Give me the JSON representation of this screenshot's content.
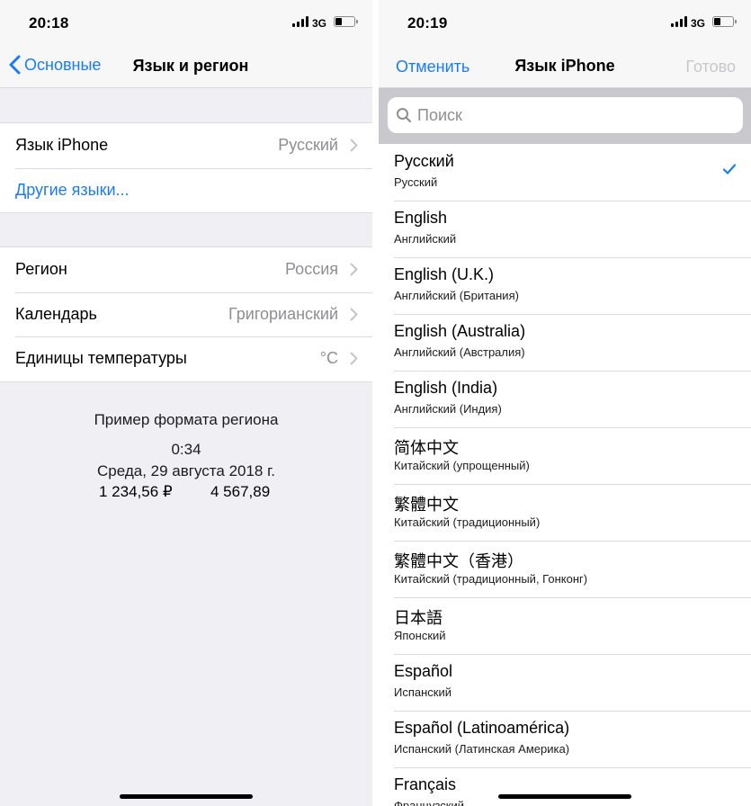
{
  "left": {
    "status": {
      "time": "20:18",
      "network": "3G"
    },
    "nav": {
      "back_label": "Основные",
      "title": "Язык и регион"
    },
    "group1": [
      {
        "label": "Язык iPhone",
        "value": "Русский"
      }
    ],
    "other_languages": "Другие языки...",
    "group2": [
      {
        "label": "Регион",
        "value": "Россия"
      },
      {
        "label": "Календарь",
        "value": "Григорианский"
      },
      {
        "label": "Единицы температуры",
        "value": "°C"
      }
    ],
    "example": {
      "heading": "Пример формата региона",
      "time": "0:34",
      "date": "Среда, 29 августа 2018 г.",
      "currency": "1 234,56 ₽",
      "number": "4 567,89"
    }
  },
  "right": {
    "status": {
      "time": "20:19",
      "network": "3G"
    },
    "nav": {
      "cancel_label": "Отменить",
      "title": "Язык iPhone",
      "done_label": "Готово"
    },
    "search": {
      "placeholder": "Поиск"
    },
    "languages": [
      {
        "name": "Русский",
        "native": "Русский",
        "selected": true
      },
      {
        "name": "English",
        "native": "Английский"
      },
      {
        "name": "English (U.K.)",
        "native": "Английский (Британия)"
      },
      {
        "name": "English (Australia)",
        "native": "Английский (Австралия)"
      },
      {
        "name": "English (India)",
        "native": "Английский (Индия)"
      },
      {
        "name": "简体中文",
        "native": "Китайский (упрощенный)"
      },
      {
        "name": "繁體中文",
        "native": "Китайский (традиционный)"
      },
      {
        "name": "繁體中文（香港）",
        "native": "Китайский (традиционный, Гонконг)"
      },
      {
        "name": "日本語",
        "native": "Японский"
      },
      {
        "name": "Español",
        "native": "Испанский"
      },
      {
        "name": "Español (Latinoamérica)",
        "native": "Испанский (Латинская Америка)"
      },
      {
        "name": "Français",
        "native": "Французский"
      }
    ]
  },
  "colors": {
    "accent": "#1a7cf5",
    "secondary_text": "#8e8e93",
    "disabled": "#c7c7cc"
  },
  "icons": {
    "back": "chevron-left-icon",
    "disclosure": "chevron-right-icon",
    "search": "magnifier-icon",
    "selected": "checkmark-icon"
  }
}
